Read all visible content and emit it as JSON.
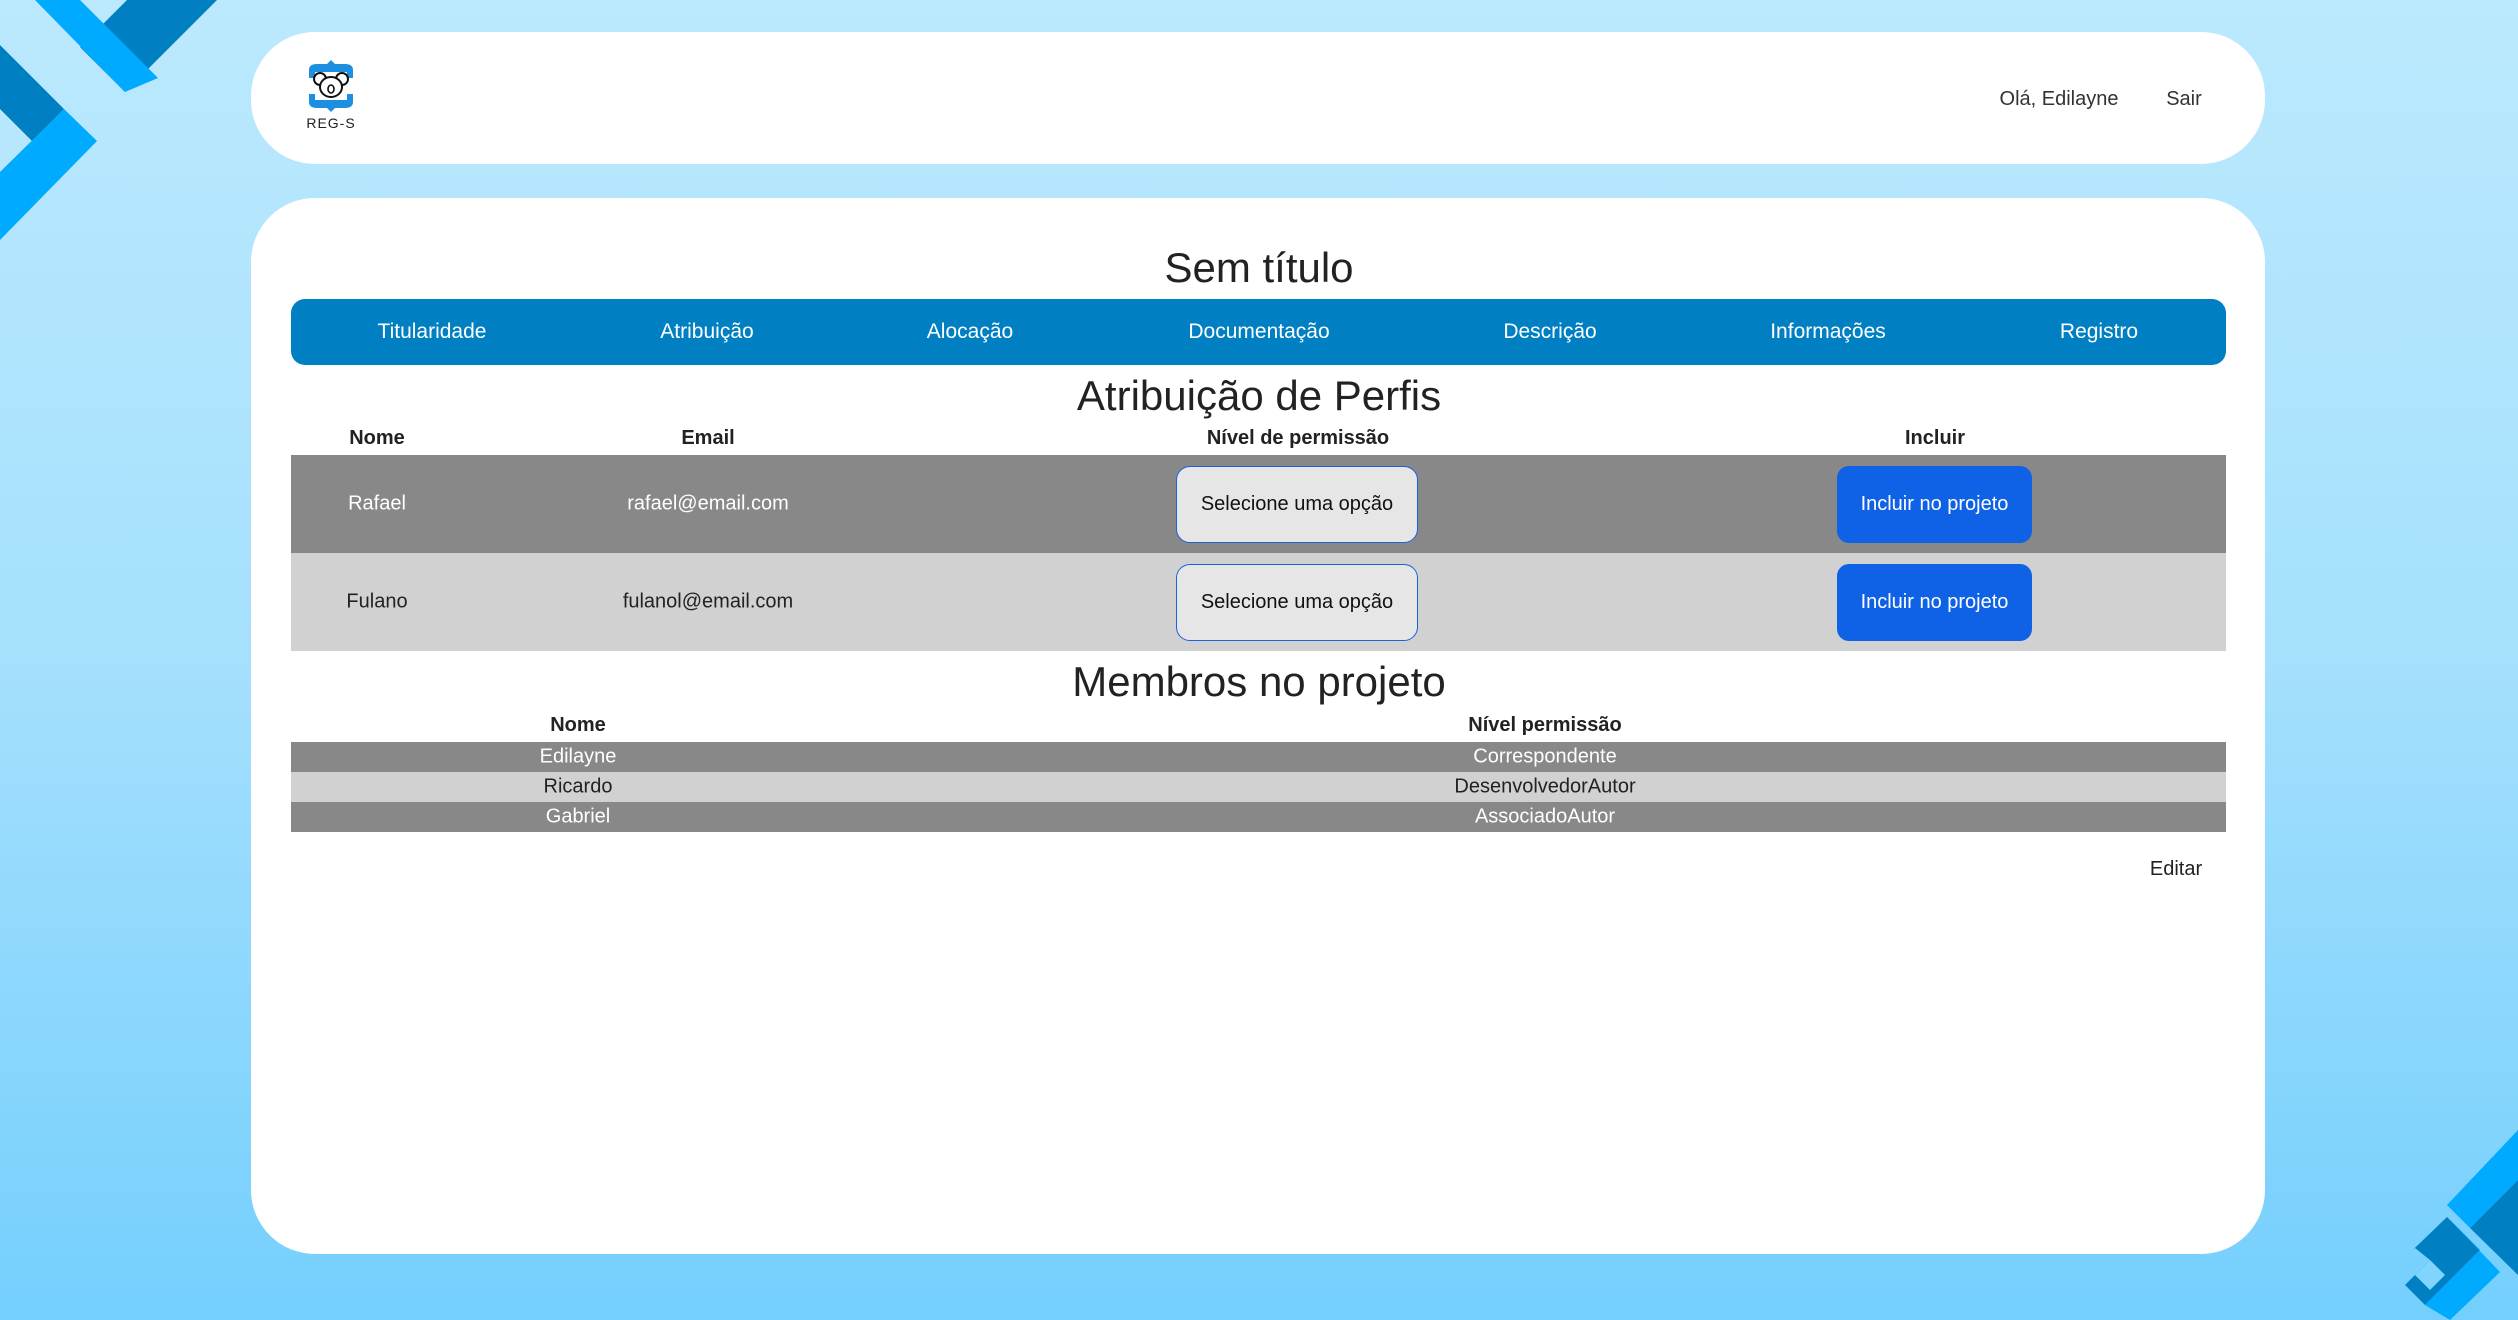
{
  "header": {
    "logo_text": "REG-S",
    "greeting": "Olá, Edilayne",
    "logout": "Sair"
  },
  "project_title": "Sem título",
  "nav": {
    "tabs": [
      "Titularidade",
      "Atribuição",
      "Alocação",
      "Documentação",
      "Descrição",
      "Informações",
      "Registro"
    ]
  },
  "assign": {
    "title": "Atribuição de Perfis",
    "columns": [
      "Nome",
      "Email",
      "Nível de permissão",
      "Incluir"
    ],
    "rows": [
      {
        "name": "Rafael",
        "email": "rafael@email.com",
        "select": "Selecione uma opção",
        "button": "Incluir no projeto"
      },
      {
        "name": "Fulano",
        "email": "fulanol@email.com",
        "select": "Selecione uma opção",
        "button": "Incluir no projeto"
      }
    ]
  },
  "members": {
    "title": "Membros no projeto",
    "columns": [
      "Nome",
      "Nível permissão"
    ],
    "rows": [
      {
        "name": "Edilayne",
        "level": "Correspondente"
      },
      {
        "name": "Ricardo",
        "level": "DesenvolvedorAutor"
      },
      {
        "name": "Gabriel",
        "level": "AssociadoAutor"
      }
    ]
  },
  "edit_label": "Editar",
  "colors": {
    "nav": "#0080c3",
    "button": "#0f62e6",
    "row_dark": "#888888",
    "row_light": "#d1d1d1"
  }
}
